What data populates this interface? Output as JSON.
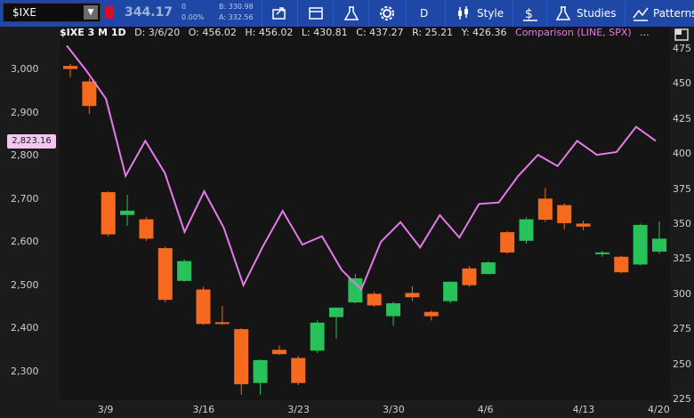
{
  "toolbar": {
    "symbol": "$IXE",
    "last_price": "344.17",
    "change_abs": "0",
    "change_pct": "0.00%",
    "bid": "B: 330.98",
    "ask": "A: 332.56",
    "aggregation": "D",
    "style_label": "Style",
    "studies_label": "Studies",
    "patterns_label": "Patterns"
  },
  "header": {
    "title": "$IXE 3 M 1D",
    "date": "D: 3/6/20",
    "open": "O: 456.02",
    "high": "H: 456.02",
    "low": "L: 430.81",
    "close": "C: 437.27",
    "range": "R: 25.21",
    "ytd": "Y: 426.36",
    "comparison": "Comparison (LINE, SPX)",
    "more": "..."
  },
  "current_price_tag": "2,823.16",
  "colors": {
    "toolbar": "#1f47a6",
    "up": "#27c25a",
    "down": "#f56a1f",
    "comparison": "#e57be8",
    "price_tag": "#f3c6f3"
  },
  "chart_data": {
    "type": "candlestick",
    "left_axis": {
      "label": "",
      "ticks": [
        "3,000",
        "2,900",
        "2,800",
        "2,700",
        "2,600",
        "2,500",
        "2,400",
        "2,300"
      ],
      "range": [
        2235,
        3065
      ]
    },
    "right_axis": {
      "label": "",
      "ticks": [
        "475",
        "450",
        "425",
        "400",
        "375",
        "350",
        "325",
        "300",
        "275",
        "250",
        "225"
      ],
      "range": [
        225,
        480
      ]
    },
    "x_ticks": [
      "3/9",
      "3/16",
      "3/23",
      "3/30",
      "4/6",
      "4/13",
      "4/20"
    ],
    "candles": [
      {
        "o": 3011,
        "h": 3016,
        "l": 2985,
        "c": 3004,
        "up": false
      },
      {
        "o": 2975,
        "h": 2982,
        "l": 2900,
        "c": 2918,
        "up": false
      },
      {
        "o": 2718,
        "h": 2720,
        "l": 2615,
        "c": 2620,
        "up": false
      },
      {
        "o": 2665,
        "h": 2712,
        "l": 2640,
        "c": 2675,
        "up": true
      },
      {
        "o": 2655,
        "h": 2660,
        "l": 2605,
        "c": 2610,
        "up": false
      },
      {
        "o": 2588,
        "h": 2592,
        "l": 2462,
        "c": 2468,
        "up": false
      },
      {
        "o": 2512,
        "h": 2562,
        "l": 2510,
        "c": 2558,
        "up": true
      },
      {
        "o": 2492,
        "h": 2498,
        "l": 2410,
        "c": 2412,
        "up": false
      },
      {
        "o": 2416,
        "h": 2454,
        "l": 2410,
        "c": 2414,
        "up": false
      },
      {
        "o": 2400,
        "h": 2402,
        "l": 2248,
        "c": 2272,
        "up": false
      },
      {
        "o": 2275,
        "h": 2330,
        "l": 2248,
        "c": 2328,
        "up": true
      },
      {
        "o": 2352,
        "h": 2362,
        "l": 2340,
        "c": 2342,
        "up": false
      },
      {
        "o": 2333,
        "h": 2338,
        "l": 2270,
        "c": 2275,
        "up": false
      },
      {
        "o": 2350,
        "h": 2420,
        "l": 2345,
        "c": 2415,
        "up": true
      },
      {
        "o": 2428,
        "h": 2448,
        "l": 2378,
        "c": 2450,
        "up": true
      },
      {
        "o": 2462,
        "h": 2528,
        "l": 2460,
        "c": 2518,
        "up": true
      },
      {
        "o": 2482,
        "h": 2486,
        "l": 2452,
        "c": 2455,
        "up": false
      },
      {
        "o": 2430,
        "h": 2463,
        "l": 2408,
        "c": 2460,
        "up": true
      },
      {
        "o": 2484,
        "h": 2500,
        "l": 2465,
        "c": 2474,
        "up": false
      },
      {
        "o": 2440,
        "h": 2443,
        "l": 2420,
        "c": 2430,
        "up": false
      },
      {
        "o": 2465,
        "h": 2511,
        "l": 2460,
        "c": 2510,
        "up": true
      },
      {
        "o": 2541,
        "h": 2546,
        "l": 2498,
        "c": 2502,
        "up": false
      },
      {
        "o": 2528,
        "h": 2558,
        "l": 2527,
        "c": 2555,
        "up": true
      },
      {
        "o": 2625,
        "h": 2628,
        "l": 2575,
        "c": 2578,
        "up": false
      },
      {
        "o": 2605,
        "h": 2660,
        "l": 2598,
        "c": 2655,
        "up": true
      },
      {
        "o": 2703,
        "h": 2728,
        "l": 2649,
        "c": 2654,
        "up": false
      },
      {
        "o": 2688,
        "h": 2692,
        "l": 2632,
        "c": 2646,
        "up": false
      },
      {
        "o": 2645,
        "h": 2652,
        "l": 2630,
        "c": 2638,
        "up": false
      },
      {
        "o": 2575,
        "h": 2582,
        "l": 2568,
        "c": 2578,
        "up": true
      },
      {
        "o": 2568,
        "h": 2570,
        "l": 2530,
        "c": 2532,
        "up": false
      },
      {
        "o": 2550,
        "h": 2645,
        "l": 2548,
        "c": 2642,
        "up": true
      },
      {
        "o": 2580,
        "h": 2650,
        "l": 2575,
        "c": 2610,
        "up": true
      }
    ],
    "comparison_line": {
      "name": "SPX",
      "values": [
        478,
        460,
        440,
        385,
        410,
        387,
        345,
        374,
        348,
        307,
        335,
        360,
        336,
        342,
        318,
        304,
        338,
        352,
        334,
        357,
        341,
        365,
        366,
        385,
        400,
        392,
        410,
        400,
        402,
        420,
        410
      ]
    }
  }
}
